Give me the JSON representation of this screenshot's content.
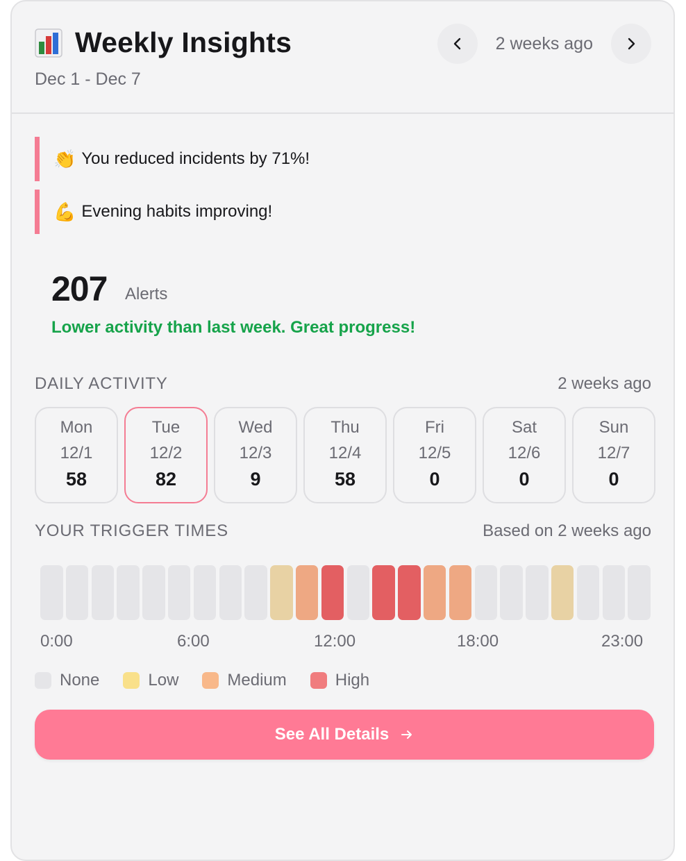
{
  "header": {
    "title": "Weekly Insights",
    "date_range": "Dec 1 - Dec 7",
    "period_label": "2 weeks ago",
    "prev_icon": "chevron-left-icon",
    "next_icon": "chevron-right-icon",
    "title_icon": "bar-chart-icon"
  },
  "banners": [
    {
      "emoji": "👏",
      "text": "You reduced incidents by 71%!"
    },
    {
      "emoji": "💪",
      "text": "Evening habits improving!"
    }
  ],
  "summary": {
    "count": "207",
    "unit": "Alerts",
    "message": "Lower activity than last week. Great progress!"
  },
  "daily_activity": {
    "title": "DAILY ACTIVITY",
    "meta": "2 weeks ago",
    "days": [
      {
        "name": "Mon",
        "date": "12/1",
        "count": "58",
        "selected": false
      },
      {
        "name": "Tue",
        "date": "12/2",
        "count": "82",
        "selected": true
      },
      {
        "name": "Wed",
        "date": "12/3",
        "count": "9",
        "selected": false
      },
      {
        "name": "Thu",
        "date": "12/4",
        "count": "58",
        "selected": false
      },
      {
        "name": "Fri",
        "date": "12/5",
        "count": "0",
        "selected": false
      },
      {
        "name": "Sat",
        "date": "12/6",
        "count": "0",
        "selected": false
      },
      {
        "name": "Sun",
        "date": "12/7",
        "count": "0",
        "selected": false
      }
    ]
  },
  "trigger_times": {
    "title": "YOUR TRIGGER TIMES",
    "meta": "Based on 2 weeks ago",
    "hours": [
      "none",
      "none",
      "none",
      "none",
      "none",
      "none",
      "none",
      "none",
      "none",
      "low",
      "medium",
      "high",
      "none",
      "high",
      "high",
      "medium",
      "medium",
      "none",
      "none",
      "none",
      "low",
      "none",
      "none",
      "none"
    ],
    "axis_labels": [
      "0:00",
      "6:00",
      "12:00",
      "18:00",
      "23:00"
    ],
    "legend": [
      {
        "key": "none",
        "label": "None"
      },
      {
        "key": "low",
        "label": "Low"
      },
      {
        "key": "medium",
        "label": "Medium"
      },
      {
        "key": "high",
        "label": "High"
      }
    ]
  },
  "colors": {
    "accent": "#ff7a95",
    "banner_bar": "#f47c93",
    "positive": "#16a34a",
    "none": "#e5e5e8",
    "low": "#e8d2a4",
    "medium": "#eea883",
    "high": "#e35f62",
    "legend_none": "#e5e5e8",
    "legend_low": "#f9e08a",
    "legend_medium": "#f8b88a",
    "legend_high": "#f07c7e"
  },
  "cta": {
    "label": "See All Details",
    "icon": "arrow-right-icon"
  }
}
